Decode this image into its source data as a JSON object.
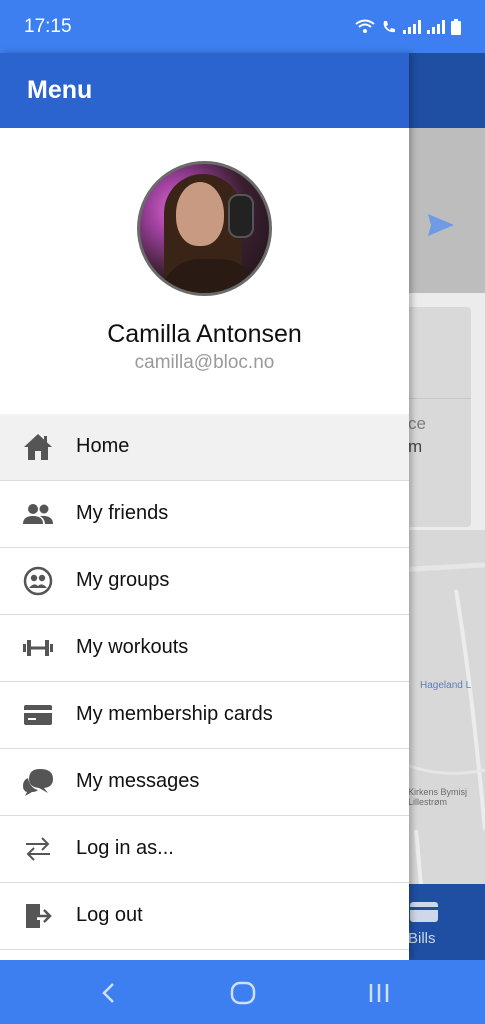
{
  "status_bar": {
    "time": "17:15",
    "icons": [
      "wifi-icon",
      "call-icon",
      "signal-icon",
      "signal-icon",
      "battery-icon"
    ]
  },
  "drawer": {
    "title": "Menu",
    "profile": {
      "name": "Camilla Antonsen",
      "email": "camilla@bloc.no"
    },
    "items": [
      {
        "label": "Home",
        "icon": "home-icon",
        "active": true
      },
      {
        "label": "My friends",
        "icon": "friends-icon"
      },
      {
        "label": "My groups",
        "icon": "groups-icon"
      },
      {
        "label": "My workouts",
        "icon": "dumbbell-icon"
      },
      {
        "label": "My membership cards",
        "icon": "card-icon"
      },
      {
        "label": "My messages",
        "icon": "messages-icon"
      },
      {
        "label": "Log in as...",
        "icon": "swap-icon"
      },
      {
        "label": "Log out",
        "icon": "logout-icon"
      }
    ]
  },
  "background": {
    "text1": "ce",
    "text2": "m",
    "map_label1": "Hageland L",
    "map_label2": "Kirkens Bymisj Lillestrøm",
    "tab_label": "Bills"
  },
  "colors": {
    "statusbar": "#3d7ff0",
    "drawer_header": "#2b63cf",
    "icon_gray": "#555555"
  }
}
